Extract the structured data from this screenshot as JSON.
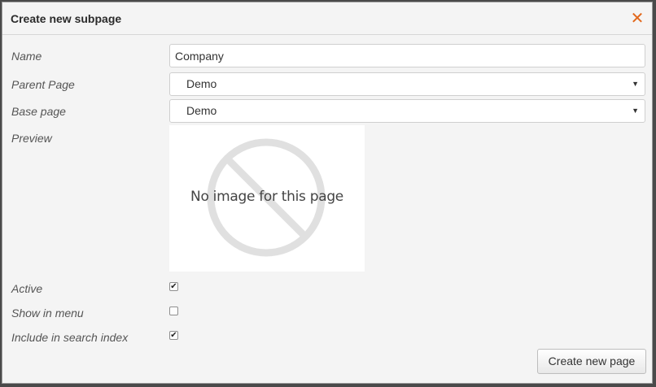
{
  "dialog": {
    "title": "Create new subpage",
    "close_icon": "close-icon"
  },
  "form": {
    "name_label": "Name",
    "name_value": "Company",
    "parent_label": "Parent Page",
    "parent_value": "Demo",
    "base_label": "Base page",
    "base_value": "Demo",
    "preview_label": "Preview",
    "preview_text": "No image for this page",
    "active_label": "Active",
    "active_checked": true,
    "menu_label": "Show in menu",
    "menu_checked": false,
    "search_label": "Include in search index",
    "search_checked": true
  },
  "footer": {
    "create_label": "Create new page"
  },
  "colors": {
    "accent": "#e2681c",
    "background": "#f4f4f4"
  }
}
